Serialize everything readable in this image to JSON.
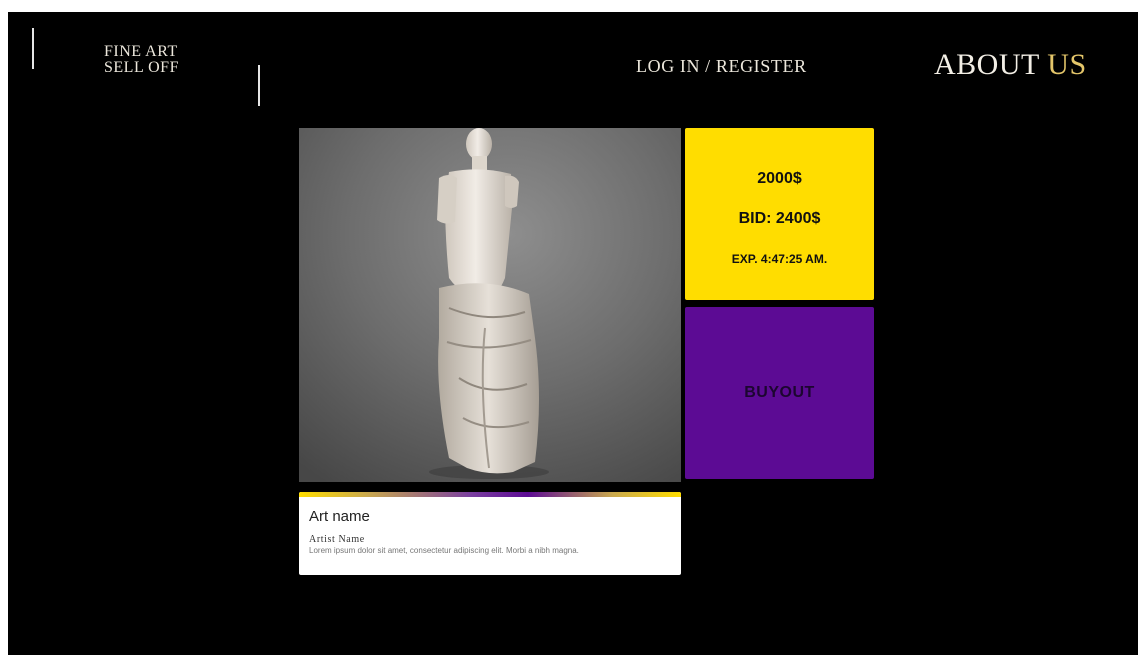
{
  "header": {
    "logo_line1": "FINE ART",
    "logo_line2": "SELL OFF",
    "login_register": "LOG IN / REGISTER",
    "about_main": "ABOUT",
    "about_accent": "US",
    "accent_color": "#e4c66a"
  },
  "listing": {
    "image_icon": "statue-image",
    "price": "2000$",
    "bid": "BID: 2400$",
    "expires": "EXP. 4:47:25 AM.",
    "buyout_label": "BUYOUT",
    "price_box_color": "#ffdd00",
    "buyout_color": "#5c0b94"
  },
  "info": {
    "art_name": "Art name",
    "artist_name": "Artist Name",
    "description": "Lorem ipsum dolor sit amet, consectetur adipiscing elit. Morbi a nibh magna."
  }
}
